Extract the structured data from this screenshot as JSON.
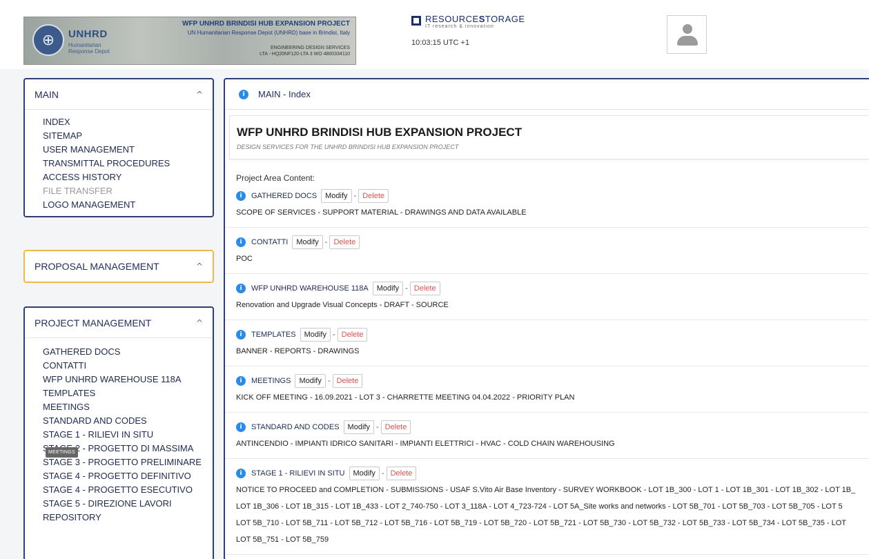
{
  "header": {
    "banner": {
      "org_name": "UNHRD",
      "org_sub": "Humanitarian Response Depot",
      "project_title": "WFP UNHRD BRINDISI HUB EXPANSION PROJECT",
      "project_sub": "UN Humanitarian Response Depot (UNHRD) base in Brindisi, Italy",
      "engineering_line1": "ENGINEERING DESIGN SERVICES",
      "engineering_line2": "LTA - HQ20NF120-LTA 3 WO 4800334110"
    },
    "brand": {
      "name_light": "RESOURCE",
      "name_bold_s": "S",
      "name_rest": "TORAGE",
      "tagline": "IT research & innovation"
    },
    "clock": "10:03:15 UTC +1"
  },
  "sidebar": {
    "main": {
      "title": "MAIN",
      "items": [
        "INDEX",
        "SITEMAP",
        "USER MANAGEMENT",
        "TRANSMITTAL PROCEDURES",
        "ACCESS HISTORY",
        "FILE TRANSFER",
        "LOGO MANAGEMENT"
      ]
    },
    "proposal": {
      "title": "PROPOSAL MANAGEMENT"
    },
    "project": {
      "title": "PROJECT MANAGEMENT",
      "items": [
        "GATHERED DOCS",
        "CONTATTI",
        "WFP UNHRD WAREHOUSE 118A",
        "TEMPLATES",
        "MEETINGS",
        "STANDARD AND CODES",
        "STAGE 1 - RILIEVI IN SITU",
        "STAGE 2 - PROGETTO DI MASSIMA",
        "STAGE 3 - PROGETTO PRELIMINARE",
        "STAGE 4 - PROGETTO DEFINITIVO",
        "STAGE 4 - PROGETTO ESECUTIVO",
        "STAGE 5 - DIREZIONE LAVORI",
        "REPOSITORY"
      ]
    },
    "tooltip": "MEETINGS"
  },
  "main": {
    "header": "MAIN - Index",
    "project_title": "WFP UNHRD BRINDISI HUB EXPANSION PROJECT",
    "project_subtitle": "DESIGN SERVICES FOR THE UNHRD BRINDISI HUB EXPANSION PROJECT",
    "area_label": "Project Area Content:",
    "modify_label": "Modify",
    "delete_label": "Delete",
    "sections": [
      {
        "title": "GATHERED DOCS",
        "lines": [
          "SCOPE OF SERVICES - SUPPORT MATERIAL - DRAWINGS AND DATA AVAILABLE"
        ]
      },
      {
        "title": "CONTATTI",
        "lines": [
          "POC"
        ]
      },
      {
        "title": "WFP UNHRD WAREHOUSE 118A",
        "lines": [
          "Renovation and Upgrade Visual Concepts - DRAFT - SOURCE"
        ]
      },
      {
        "title": "TEMPLATES",
        "lines": [
          "BANNER - REPORTS - DRAWINGS"
        ]
      },
      {
        "title": "MEETINGS",
        "lines": [
          "KICK OFF MEETING - 16.09.2021 - LOT 3 - CHARRETTE MEETING 04.04.2022 - PRIORITY PLAN"
        ]
      },
      {
        "title": "STANDARD AND CODES",
        "lines": [
          "ANTINCENDIO - IMPIANTI IDRICO SANITARI - IMPIANTI ELETTRICI - HVAC - COLD CHAIN WAREHOUSING"
        ]
      },
      {
        "title": "STAGE 1 - RILIEVI IN SITU",
        "lines": [
          "NOTICE TO PROCEED and COMPLETION - SUBMISSIONS - USAF S.Vito Air Base Inventory - SURVEY WORKBOOK - LOT 1B_300 - LOT 1 - LOT 1B_301 - LOT 1B_302 - LOT 1B_",
          "LOT 1B_306 - LOT 1B_315 - LOT 1B_433 - LOT 2_740-750 - LOT 3_118A - LOT 4_723-724 - LOT 5A_Site works and networks - LOT 5B_701 - LOT 5B_703 - LOT 5B_705 - LOT 5",
          "LOT 5B_710 - LOT 5B_711 - LOT 5B_712 - LOT 5B_716 - LOT 5B_719 - LOT 5B_720 - LOT 5B_721 - LOT 5B_730 - LOT 5B_732 - LOT 5B_733 - LOT 5B_734 - LOT 5B_735 - LOT",
          "LOT 5B_751 - LOT 5B_759"
        ]
      }
    ]
  }
}
